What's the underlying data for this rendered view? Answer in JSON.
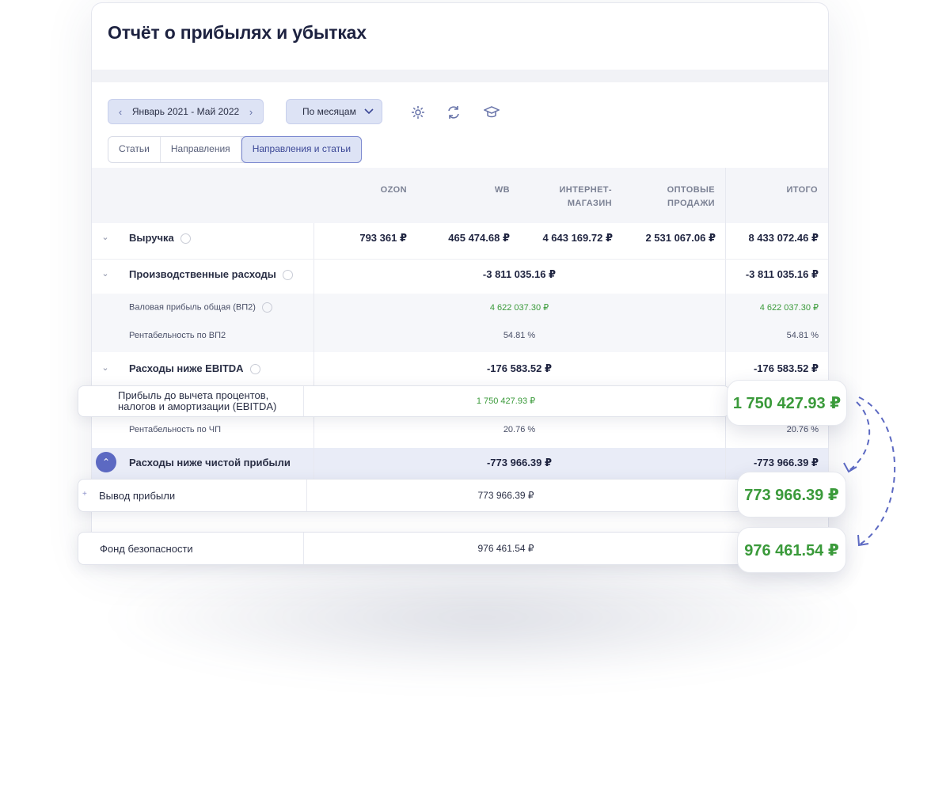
{
  "header": {
    "title": "Отчёт о прибылях и убытках"
  },
  "toolbar": {
    "date_range": "Январь 2021 - Май 2022",
    "period": "По месяцам",
    "icons": [
      "settings-icon",
      "refresh-icon",
      "education-icon"
    ]
  },
  "tabs": [
    {
      "label": "Статьи",
      "active": false
    },
    {
      "label": "Направления",
      "active": false
    },
    {
      "label": "Направления и статьи",
      "active": true
    }
  ],
  "columns": {
    "ozon": "OZON",
    "wb": "WB",
    "internet_1": "ИНТЕРНЕТ-",
    "internet_2": "МАГАЗИН",
    "wholesale_1": "ОПТОВЫЕ",
    "wholesale_2": "ПРОДАЖИ",
    "total": "ИТОГО"
  },
  "rows": {
    "revenue": {
      "name": "Выручка",
      "ozon": "793 361 ₽",
      "wb": "465 474.68 ₽",
      "internet": "4 643 169.72 ₽",
      "wholesale": "2 531 067.06 ₽",
      "total": "8 433 072.46 ₽"
    },
    "production": {
      "name": "Производственные расходы",
      "value": "-3 811 035.16 ₽",
      "total": "-3 811 035.16 ₽"
    },
    "gross_profit": {
      "name": "Валовая прибыль общая (ВП2)",
      "value": "4 622 037.30 ₽",
      "total": "4 622 037.30 ₽"
    },
    "gp_margin": {
      "name": "Рентабельность по ВП2",
      "value": "54.81 %",
      "total": "54.81 %"
    },
    "below_ebitda": {
      "name": "Расходы ниже EBITDA",
      "value": "-176 583.52 ₽",
      "total": "-176 583.52 ₽"
    },
    "np_margin": {
      "name": "Рентабельность по ЧП",
      "value": "20.76 %",
      "total": "20.76 %"
    },
    "below_net": {
      "name": "Расходы ниже чистой прибыли",
      "value": "-773 966.39 ₽",
      "total": "-773 966.39 ₽"
    }
  },
  "floating": {
    "ebitda": {
      "label_1": "Прибыль до вычета процентов,",
      "label_2": "налогов и амортизации (EBITDA)",
      "value": "1 750 427.93 ₽",
      "badge": "1 750 427.93 ₽"
    },
    "withdrawal": {
      "label": "Вывод прибыли",
      "value": "773 966.39 ₽",
      "badge": "773 966.39 ₽"
    },
    "safety_fund": {
      "label": "Фонд безопасности",
      "value": "976 461.54 ₽",
      "badge": "976 461.54 ₽"
    }
  },
  "colors": {
    "accent": "#5c69c2",
    "positive": "#3a9a3a",
    "chip_bg": "#dde3f5"
  }
}
